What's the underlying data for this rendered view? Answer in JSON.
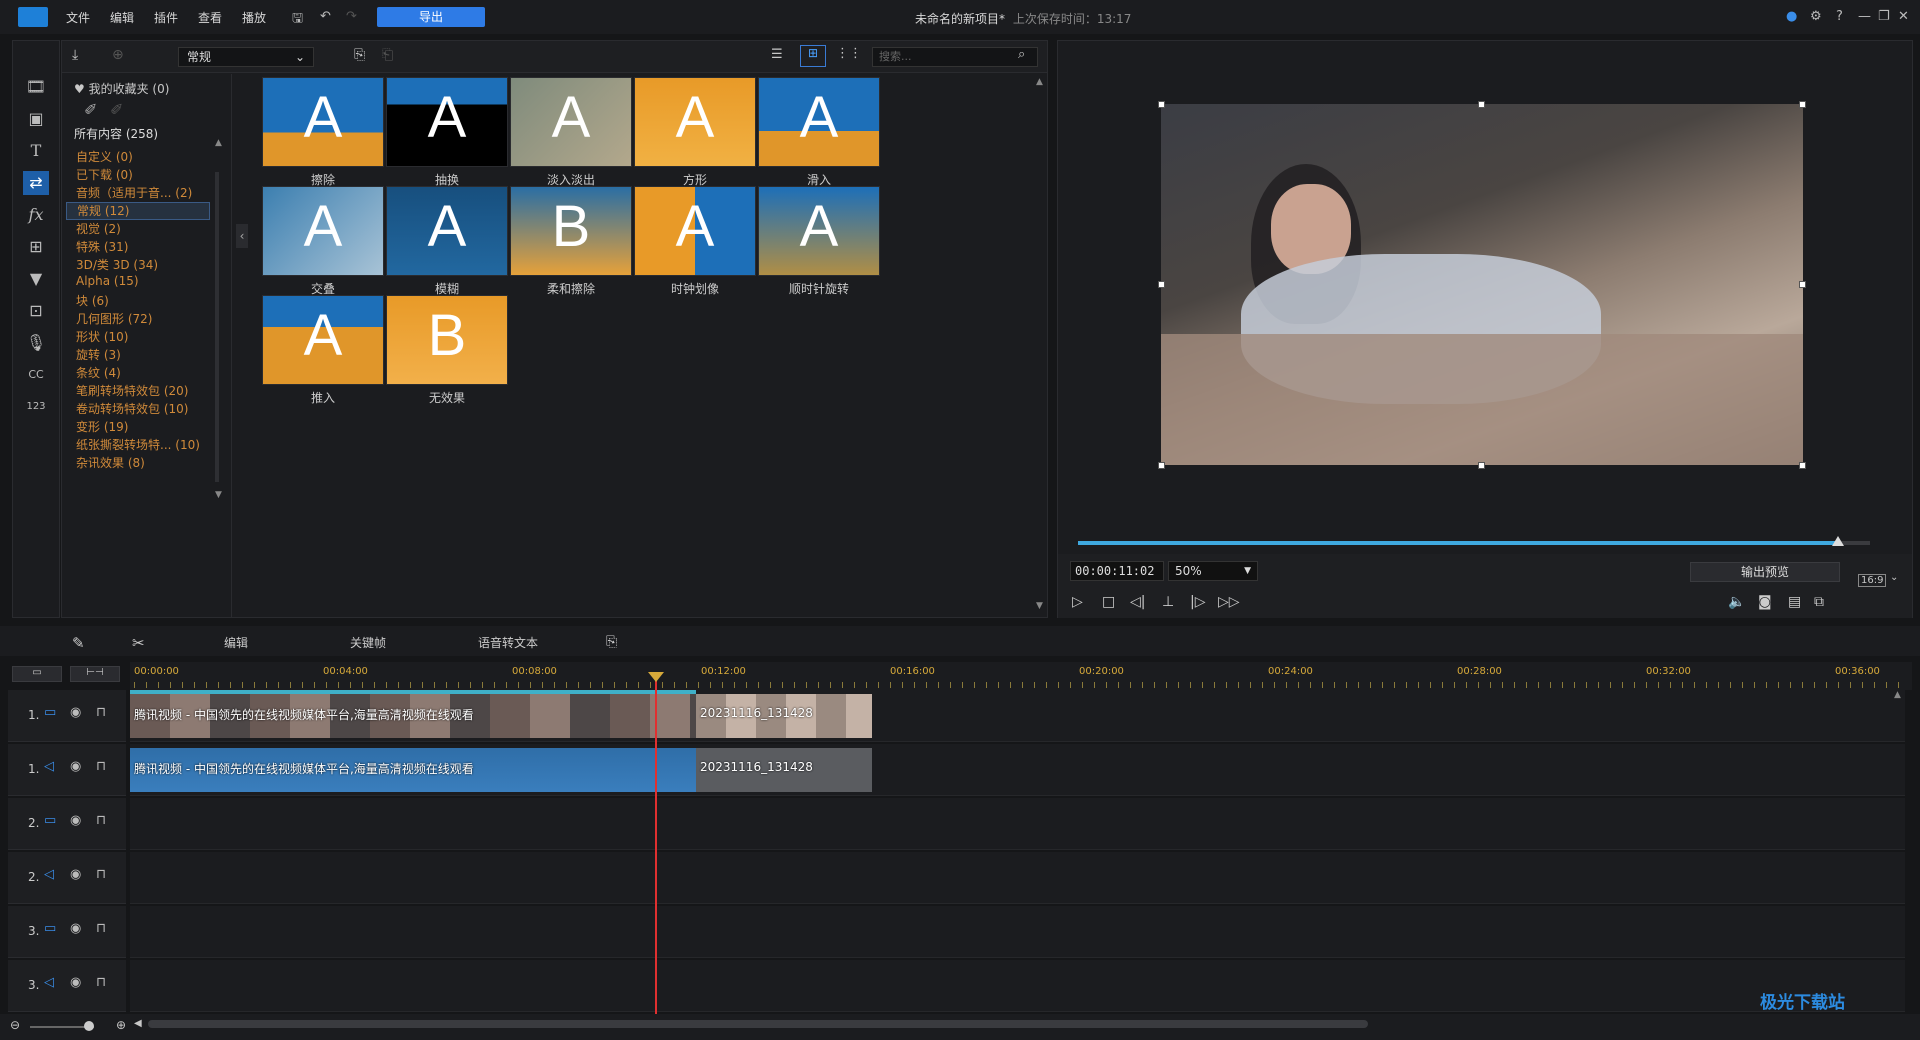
{
  "titlebar": {
    "menus": [
      "文件",
      "编辑",
      "插件",
      "查看",
      "播放"
    ],
    "export_label": "导出",
    "project_title": "未命名的新项目*",
    "last_saved": "上次保存时间：13:17"
  },
  "library": {
    "category_dropdown": "常规",
    "search_placeholder": "搜索...",
    "favorites": "我的收藏夹 (0)",
    "all_content": "所有内容 (258)",
    "categories": [
      "自定义 (0)",
      "已下载 (0)",
      "音频（适用于音... (2)",
      "常规 (12)",
      "视觉 (2)",
      "特殊 (31)",
      "3D/类 3D (34)",
      "Alpha (15)",
      "块 (6)",
      "几何图形 (72)",
      "形状 (10)",
      "旋转 (3)",
      "条纹 (4)",
      "笔刷转场特效包 (20)",
      "卷动转场特效包 (10)",
      "变形 (19)",
      "纸张撕裂转场特... (10)",
      "杂讯效果 (8)"
    ],
    "selected_category": "常规 (12)",
    "transitions": [
      "擦除",
      "抽换",
      "淡入淡出",
      "方形",
      "滑入",
      "交叠",
      "模糊",
      "柔和擦除",
      "时钟划像",
      "顺时针旋转",
      "推入",
      "无效果"
    ]
  },
  "preview": {
    "timecode": "00:00:11:02",
    "zoom": "50%",
    "output_preview_label": "输出预览",
    "aspect": "16:9",
    "progress": 0.96
  },
  "timeline": {
    "toolbar": {
      "edit": "编辑",
      "keyframe": "关键帧",
      "speech_to_text": "语音转文本"
    },
    "ruler": [
      "00:00:00",
      "00:04:00",
      "00:08:00",
      "00:12:00",
      "00:16:00",
      "00:20:00",
      "00:24:00",
      "00:28:00",
      "00:32:00",
      "00:36:00"
    ],
    "tracks": [
      {
        "num": "1.",
        "kind": "video"
      },
      {
        "num": "1.",
        "kind": "audio"
      },
      {
        "num": "2.",
        "kind": "video"
      },
      {
        "num": "2.",
        "kind": "audio"
      },
      {
        "num": "3.",
        "kind": "video"
      },
      {
        "num": "3.",
        "kind": "audio"
      }
    ],
    "clips": {
      "video1_a": "腾讯视频 - 中国领先的在线视频媒体平台,海量高清视频在线观看",
      "video1_b": "20231116_131428",
      "audio1_a": "腾讯视频 - 中国领先的在线视频媒体平台,海量高清视频在线观看",
      "audio1_b": "20231116_131428"
    }
  },
  "watermark": "极光下载站"
}
